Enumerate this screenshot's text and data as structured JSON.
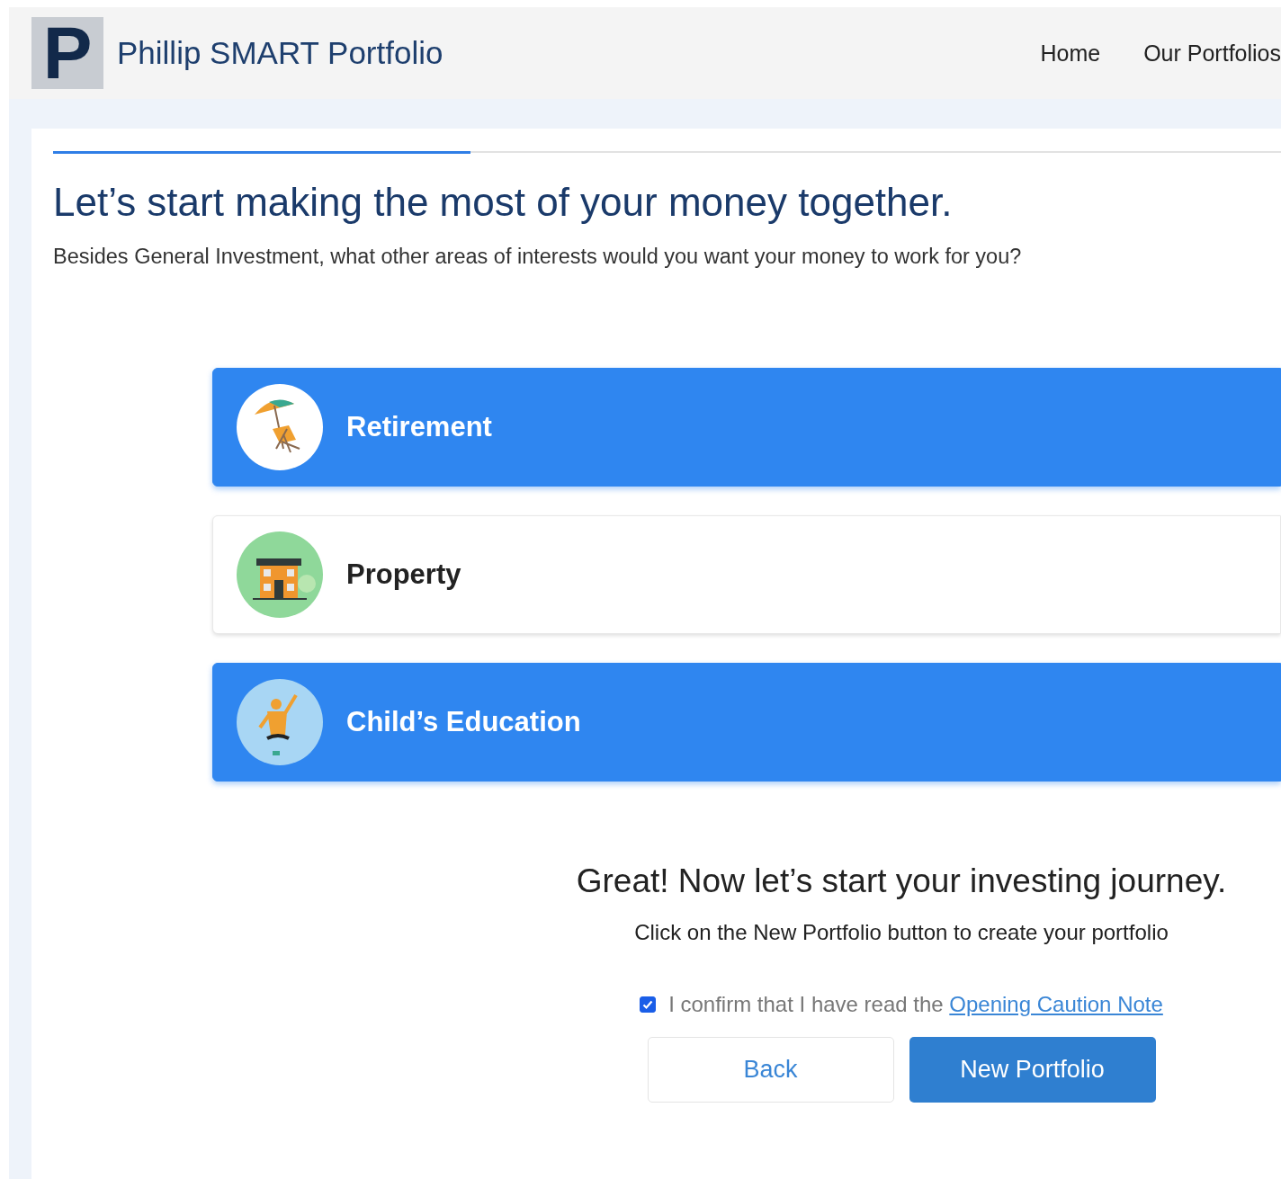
{
  "header": {
    "brand": "Phillip SMART Portfolio",
    "logo_letter": "P",
    "nav": [
      "Home",
      "Our Portfolios"
    ]
  },
  "progress": {
    "level": 0.34
  },
  "title": "Let’s start making the most of your money together.",
  "subtitle": "Besides General Investment, what other areas of interests would you want your money to work for you?",
  "options": [
    {
      "label": "Retirement",
      "kind": "beach",
      "selected": true
    },
    {
      "label": "Property",
      "kind": "house",
      "selected": false
    },
    {
      "label": "Child’s Education",
      "kind": "graduate",
      "selected": true
    }
  ],
  "closing": {
    "heading": "Great! Now let’s start your investing journey.",
    "note": "Click on the New Portfolio button to create your portfolio"
  },
  "confirm": {
    "checked": true,
    "text": "I confirm that I have read the",
    "link": "Opening Caution Note"
  },
  "buttons": {
    "back": "Back",
    "primary": "New Portfolio"
  }
}
